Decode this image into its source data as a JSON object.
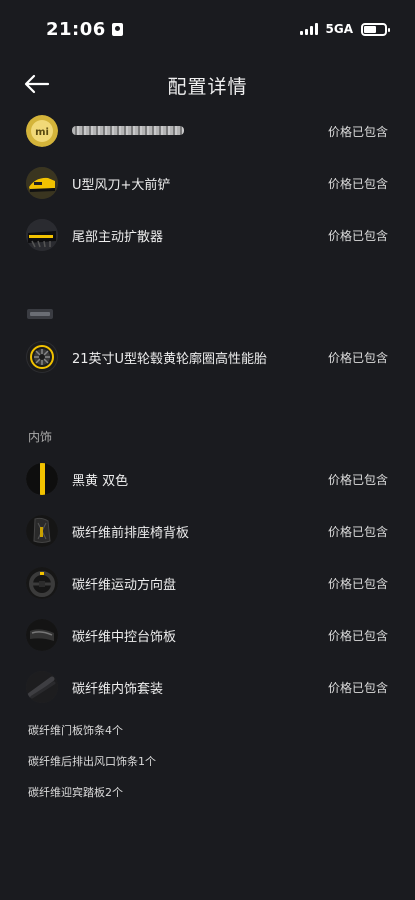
{
  "status": {
    "time": "21:06",
    "network": "5GA",
    "battery_level": 0.6
  },
  "header": {
    "title": "配置详情",
    "back_icon": "arrow-left-icon"
  },
  "items": [
    {
      "label": "",
      "price": "价格已包含",
      "icon": "mi-logo-icon"
    },
    {
      "label": "U型风刀+大前铲",
      "price": "价格已包含",
      "icon": "front-splitter-icon"
    },
    {
      "label": "尾部主动扩散器",
      "price": "价格已包含",
      "icon": "rear-diffuser-icon"
    },
    {
      "label": "21英寸U型轮毂黄轮廓圈高性能胎",
      "price": "价格已包含",
      "icon": "wheel-icon"
    }
  ],
  "interior": {
    "title": "内饰",
    "items": [
      {
        "label": "黑黄 双色",
        "price": "价格已包含",
        "icon": "color-swatch-icon"
      },
      {
        "label": "碳纤维前排座椅背板",
        "price": "价格已包含",
        "icon": "seat-back-icon"
      },
      {
        "label": "碳纤维运动方向盘",
        "price": "价格已包含",
        "icon": "steering-wheel-icon"
      },
      {
        "label": "碳纤维中控台饰板",
        "price": "价格已包含",
        "icon": "console-trim-icon"
      },
      {
        "label": "碳纤维内饰套装",
        "price": "价格已包含",
        "icon": "interior-kit-icon"
      }
    ],
    "extras": [
      "碳纤维门板饰条4个",
      "碳纤维后排出风口饰条1个",
      "碳纤维迎宾踏板2个"
    ]
  },
  "colors": {
    "background": "#1a1b1f",
    "accent_yellow": "#f2c200"
  }
}
